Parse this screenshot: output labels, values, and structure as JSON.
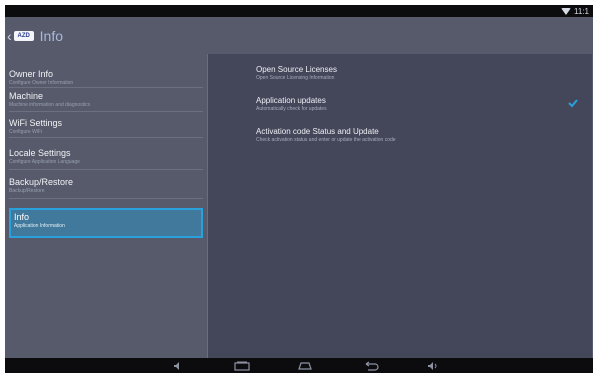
{
  "status_bar": {
    "time": "11:1"
  },
  "action_bar": {
    "logo_text": "AZD",
    "title": "Info"
  },
  "sidebar": {
    "items": [
      {
        "title": "Owner Info",
        "subtitle": "Configure Owner Information"
      },
      {
        "title": "Machine",
        "subtitle": "Machine information and diagnostics"
      },
      {
        "title": "WiFi Settings",
        "subtitle": "Configure WiFi"
      },
      {
        "title": "Locale Settings",
        "subtitle": "Configure Application Language"
      },
      {
        "title": "Backup/Restore",
        "subtitle": "Backup/Restore"
      },
      {
        "title": "Info",
        "subtitle": "Application Information",
        "selected": true
      }
    ]
  },
  "preferences": [
    {
      "title": "Open Source Licenses",
      "summary": "Open Source Licensing Information"
    },
    {
      "title": "Application updates",
      "summary": "Automatically check for updates",
      "checked": true
    },
    {
      "title": "Activation code Status and Update",
      "summary": "Check activation status and enter or update the activation code"
    }
  ],
  "colors": {
    "accent": "#2aa0dc",
    "checkmark": "#2aa0dc"
  },
  "nav_icons": [
    "volume-down-icon",
    "recent-apps-icon",
    "home-icon",
    "back-icon",
    "volume-up-icon"
  ]
}
